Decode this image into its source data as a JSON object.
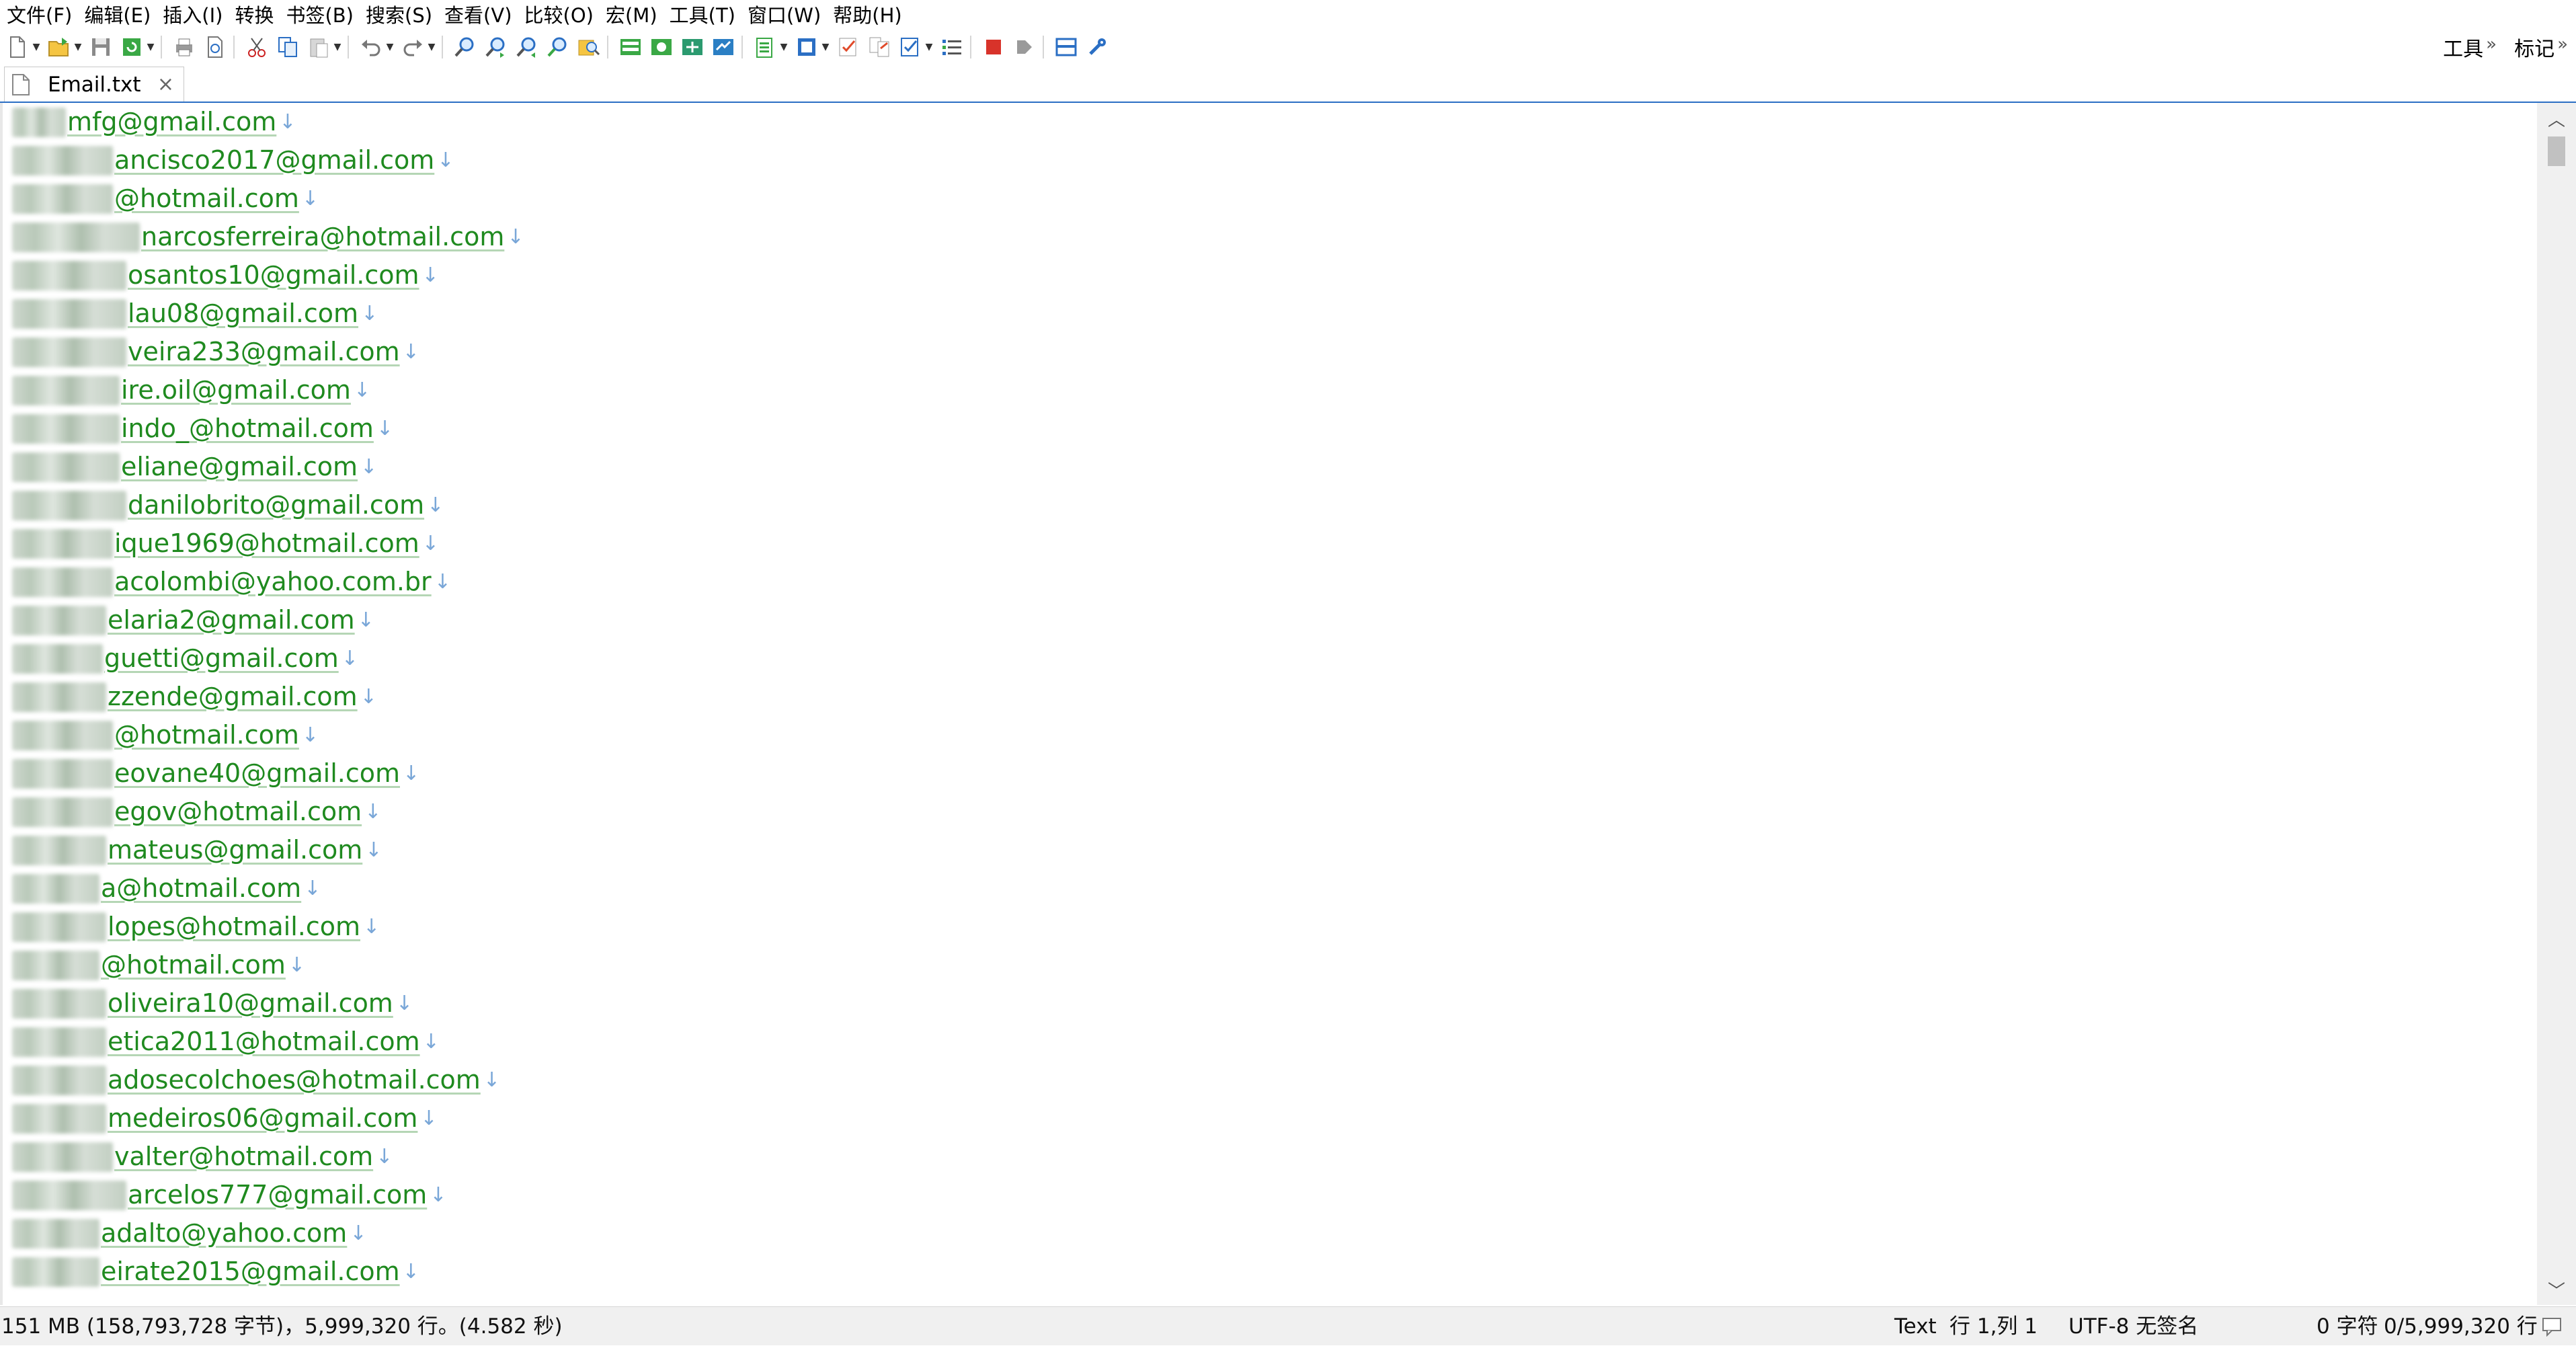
{
  "menu": [
    "文件(F)",
    "编辑(E)",
    "插入(I)",
    "转换",
    "书签(B)",
    "搜索(S)",
    "查看(V)",
    "比较(O)",
    "宏(M)",
    "工具(T)",
    "窗口(W)",
    "帮助(H)"
  ],
  "toolbar": {
    "icons": [
      "new-file-icon",
      "open-file-icon",
      "save-icon",
      "revert-icon",
      "print-icon",
      "print-preview-icon",
      "cut-icon",
      "copy-icon",
      "paste-icon",
      "undo-icon",
      "redo-icon",
      "find-icon",
      "find-next-icon",
      "find-prev-icon",
      "replace-icon",
      "find-in-files-icon",
      "column-mode-icon",
      "word-wrap-icon",
      "hex-icon",
      "browser-icon",
      "clipboard-icon",
      "macro-icon",
      "spellcheck-icon",
      "compare-icon",
      "check-icon",
      "list-icon",
      "stop-record-icon",
      "play-macro-icon",
      "split-view-icon",
      "settings-icon"
    ],
    "right_panels": [
      "工具",
      "标记"
    ]
  },
  "tab": {
    "label": "Email.txt"
  },
  "editor": {
    "lines": [
      "mfg@gmail.com",
      "ancisco2017@gmail.com",
      "@hotmail.com",
      "narcosferreira@hotmail.com",
      "osantos10@gmail.com",
      "lau08@gmail.com",
      "veira233@gmail.com",
      "ire.oil@gmail.com",
      "indo_@hotmail.com",
      "eliane@gmail.com",
      "danilobrito@gmail.com",
      "ique1969@hotmail.com",
      "acolombi@yahoo.com.br",
      "elaria2@gmail.com",
      "guetti@gmail.com",
      "zzende@gmail.com",
      "@hotmail.com",
      "eovane40@gmail.com",
      "egov@hotmail.com",
      "mateus@gmail.com",
      "a@hotmail.com",
      "lopes@hotmail.com",
      "@hotmail.com",
      "oliveira10@gmail.com",
      "etica2011@hotmail.com",
      "adosecolchoes@hotmail.com",
      "medeiros06@gmail.com",
      "valter@hotmail.com",
      "arcelos777@gmail.com",
      "adalto@yahoo.com",
      "eirate2015@gmail.com"
    ],
    "eol_marker": "↓"
  },
  "statusbar": {
    "info": "151 MB (158,793,728 字节)，5,999,320 行。(4.582 秒)",
    "mode": "Text",
    "position": "行 1,列 1",
    "encoding": "UTF-8 无签名",
    "chars": "0 字符",
    "lines": "0/5,999,320 行"
  },
  "colors": {
    "text_green": "#1f8a1f",
    "accent_blue": "#2b6fc4",
    "eol_blue": "#7aa7d8"
  }
}
